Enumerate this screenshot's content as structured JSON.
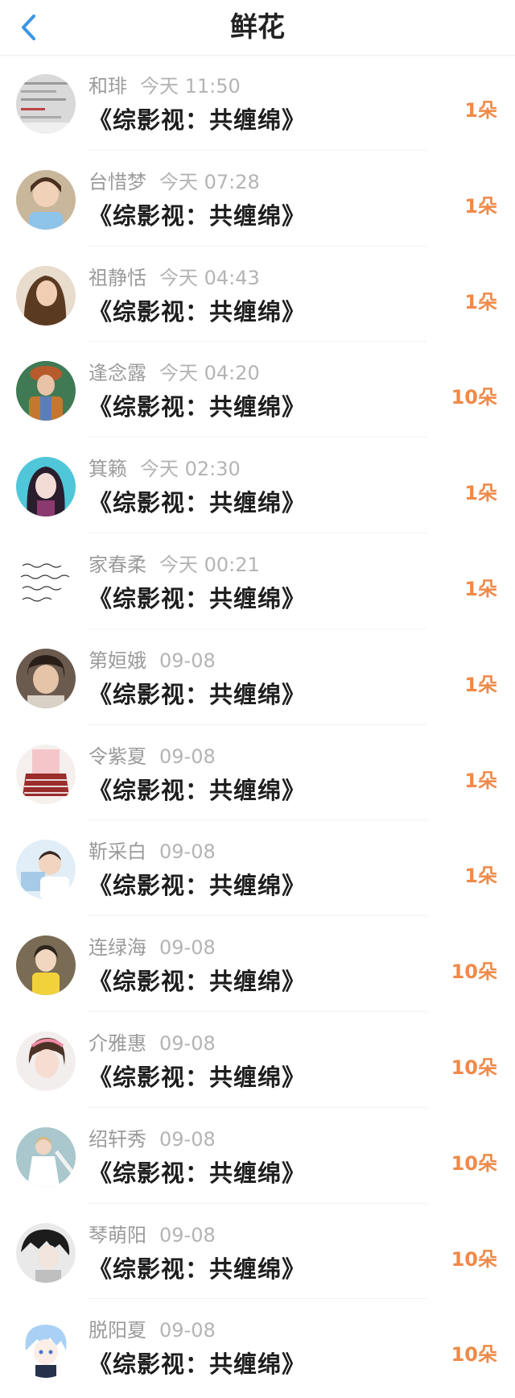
{
  "header": {
    "title": "鲜花"
  },
  "accent": "#ef8a48",
  "back_icon_color": "#3b97e3",
  "rows": [
    {
      "name": "和琲",
      "time": "今天 11:50",
      "book": "《综影视：共缠绵》",
      "count": "1朵",
      "avatar": "avatar-screenshot"
    },
    {
      "name": "台惜梦",
      "time": "今天 07:28",
      "book": "《综影视：共缠绵》",
      "count": "1朵",
      "avatar": "avatar-child"
    },
    {
      "name": "祖静恬",
      "time": "今天 04:43",
      "book": "《综影视：共缠绵》",
      "count": "1朵",
      "avatar": "avatar-woman"
    },
    {
      "name": "逢念露",
      "time": "今天 04:20",
      "book": "《综影视：共缠绵》",
      "count": "10朵",
      "avatar": "avatar-man"
    },
    {
      "name": "箕籁",
      "time": "今天 02:30",
      "book": "《综影视：共缠绵》",
      "count": "1朵",
      "avatar": "avatar-illustration"
    },
    {
      "name": "家春柔",
      "time": "今天 00:21",
      "book": "《综影视：共缠绵》",
      "count": "1朵",
      "avatar": "avatar-handwriting"
    },
    {
      "name": "第姮娥",
      "time": "09-08",
      "book": "《综影视：共缠绵》",
      "count": "1朵",
      "avatar": "avatar-boy"
    },
    {
      "name": "令紫夏",
      "time": "09-08",
      "book": "《综影视：共缠绵》",
      "count": "1朵",
      "avatar": "avatar-skirt"
    },
    {
      "name": "靳采白",
      "time": "09-08",
      "book": "《综影视：共缠绵》",
      "count": "1朵",
      "avatar": "avatar-kid"
    },
    {
      "name": "连绿海",
      "time": "09-08",
      "book": "《综影视：共缠绵》",
      "count": "10朵",
      "avatar": "avatar-girl-yellow"
    },
    {
      "name": "介雅惠",
      "time": "09-08",
      "book": "《综影视：共缠绵》",
      "count": "10朵",
      "avatar": "avatar-girl-headband"
    },
    {
      "name": "绍轩秀",
      "time": "09-08",
      "book": "《综影视：共缠绵》",
      "count": "10朵",
      "avatar": "avatar-girl-white"
    },
    {
      "name": "琴萌阳",
      "time": "09-08",
      "book": "《综影视：共缠绵》",
      "count": "10朵",
      "avatar": "avatar-sketch"
    },
    {
      "name": "脱阳夏",
      "time": "09-08",
      "book": "《综影视：共缠绵》",
      "count": "10朵",
      "avatar": "avatar-anime"
    }
  ]
}
